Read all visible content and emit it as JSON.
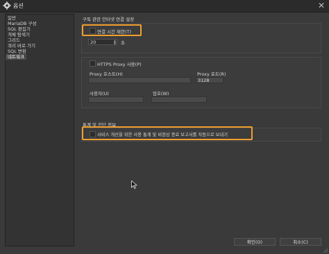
{
  "window": {
    "title": "옵션",
    "close_glyph": "✕"
  },
  "sidebar": {
    "items": [
      {
        "label": "일반"
      },
      {
        "label": "MariaDB 구성"
      },
      {
        "label": "SQL 편집기"
      },
      {
        "label": "개체 탐색기"
      },
      {
        "label": "그리드"
      },
      {
        "label": "쿼리 바로 가기"
      },
      {
        "label": "SQL 변환"
      },
      {
        "label": "네트워크",
        "selected": true
      }
    ]
  },
  "connection": {
    "section_title": "구독 관련 인터넷 연결 설정",
    "time_limit_label": "연결 시간 제한(T)",
    "time_limit_checked": false,
    "time_value": "20",
    "time_unit": "초"
  },
  "proxy": {
    "use_label": "HTTPS Proxy 사용(P)",
    "use_checked": false,
    "host_label": "Proxy 호스트(H)",
    "host_value": "",
    "port_label": "Proxy 포트(R)",
    "port_value": "3128",
    "user_label": "사용자(U)",
    "user_value": "",
    "password_label": "암호(W)",
    "password_value": ""
  },
  "statistics": {
    "section_title": "통계 및 진단 정보",
    "send_label": "서비스 개선을 위한 사용 통계 및 비정상 종료 보고서를 자동으로 보내기",
    "send_checked": false
  },
  "buttons": {
    "ok_label": "확인(O)",
    "cancel_label": "취소(C)"
  },
  "colors": {
    "highlight": "#f0a030",
    "background": "#3a3a3a"
  }
}
